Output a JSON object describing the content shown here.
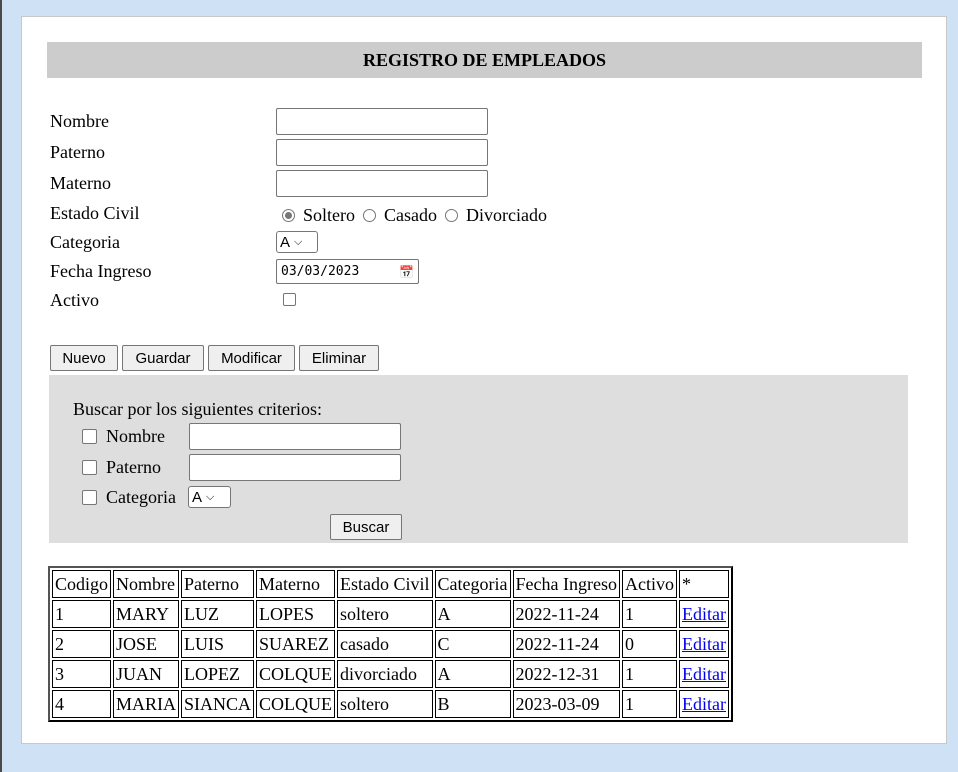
{
  "title": "REGISTRO DE EMPLEADOS",
  "form": {
    "nombre_label": "Nombre",
    "paterno_label": "Paterno",
    "materno_label": "Materno",
    "estado_civil_label": "Estado Civil",
    "estado_civil_options": [
      "Soltero",
      "Casado",
      "Divorciado"
    ],
    "estado_civil_selected": "Soltero",
    "categoria_label": "Categoria",
    "categoria_value": "A",
    "fecha_label": "Fecha Ingreso",
    "fecha_value": "03/03/2023",
    "activo_label": "Activo",
    "activo_checked": false
  },
  "buttons": {
    "nuevo": "Nuevo",
    "guardar": "Guardar",
    "modificar": "Modificar",
    "eliminar": "Eliminar"
  },
  "search": {
    "heading": "Buscar por los siguientes criterios:",
    "nombre_label": "Nombre",
    "paterno_label": "Paterno",
    "categoria_label": "Categoria",
    "categoria_value": "A",
    "button": "Buscar"
  },
  "table": {
    "headers": [
      "Codigo",
      "Nombre",
      "Paterno",
      "Materno",
      "Estado Civil",
      "Categoria",
      "Fecha Ingreso",
      "Activo",
      "*"
    ],
    "rows": [
      [
        "1",
        "MARY",
        "LUZ",
        "LOPES",
        "soltero",
        "A",
        "2022-11-24",
        "1",
        "Editar"
      ],
      [
        "2",
        "JOSE",
        "LUIS",
        "SUAREZ",
        "casado",
        "C",
        "2022-11-24",
        "0",
        "Editar"
      ],
      [
        "3",
        "JUAN",
        "LOPEZ",
        "COLQUE",
        "divorciado",
        "A",
        "2022-12-31",
        "1",
        "Editar"
      ],
      [
        "4",
        "MARIA",
        "SIANCA",
        "COLQUE",
        "soltero",
        "B",
        "2023-03-09",
        "1",
        "Editar"
      ]
    ]
  }
}
